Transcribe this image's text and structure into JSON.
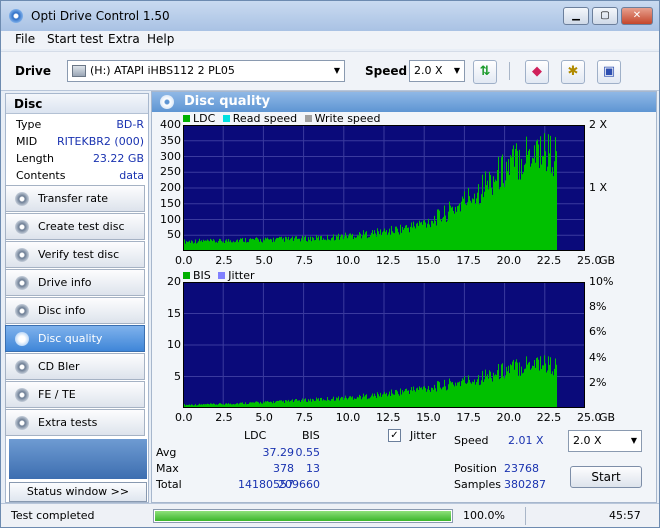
{
  "window": {
    "title": "Opti Drive Control 1.50",
    "minimize_icon": "minimize-icon",
    "maximize_icon": "maximize-icon",
    "close_icon": "close-icon"
  },
  "menu": [
    "File",
    "Start test",
    "Extra",
    "Help"
  ],
  "toolbar": {
    "drive_label": "Drive",
    "drive_value": "(H:)   ATAPI iHBS112   2 PL05",
    "speed_label": "Speed",
    "speed_value": "2.0 X",
    "buttons": [
      "refresh-icon",
      "eraser-icon",
      "settings-icon",
      "save-icon"
    ]
  },
  "disc": {
    "header": "Disc",
    "rows": [
      {
        "k": "Type",
        "v": "BD-R"
      },
      {
        "k": "MID",
        "v": "RITEKBR2 (000)"
      },
      {
        "k": "Length",
        "v": "23.22 GB"
      },
      {
        "k": "Contents",
        "v": "data"
      }
    ]
  },
  "nav": [
    {
      "label": "Transfer rate",
      "active": false
    },
    {
      "label": "Create test disc",
      "active": false
    },
    {
      "label": "Verify test disc",
      "active": false
    },
    {
      "label": "Drive info",
      "active": false
    },
    {
      "label": "Disc info",
      "active": false
    },
    {
      "label": "Disc quality",
      "active": true
    },
    {
      "label": "CD Bler",
      "active": false
    },
    {
      "label": "FE / TE",
      "active": false
    },
    {
      "label": "Extra tests",
      "active": false
    }
  ],
  "status_window_label": "Status window >>",
  "panel_title": "Disc quality",
  "chart_data": [
    {
      "type": "area",
      "legend": [
        "LDC",
        "Read speed",
        "Write speed"
      ],
      "x_unit": "GB",
      "x_ticks": [
        "0.0",
        "2.5",
        "5.0",
        "7.5",
        "10.0",
        "12.5",
        "15.0",
        "17.5",
        "20.0",
        "22.5",
        "25.0"
      ],
      "xlim": [
        0,
        25
      ],
      "y_ticks": [
        "50",
        "100",
        "150",
        "200",
        "250",
        "300",
        "350",
        "400"
      ],
      "ylim": [
        0,
        400
      ],
      "y2_ticks": [
        "1 X",
        "2 X"
      ],
      "series": [
        {
          "name": "LDC",
          "color": "#00c000",
          "x": [
            0,
            1,
            2,
            3,
            4,
            5,
            6,
            7,
            8,
            9,
            10,
            11,
            12,
            13,
            14,
            15,
            16,
            17,
            18,
            19,
            20,
            21,
            22,
            23.2
          ],
          "values": [
            30,
            32,
            30,
            34,
            36,
            35,
            37,
            38,
            40,
            42,
            48,
            52,
            58,
            65,
            75,
            90,
            110,
            140,
            180,
            220,
            260,
            300,
            330,
            300
          ]
        }
      ],
      "grid": true
    },
    {
      "type": "area",
      "legend": [
        "BIS",
        "Jitter"
      ],
      "x_unit": "GB",
      "x_ticks": [
        "0.0",
        "2.5",
        "5.0",
        "7.5",
        "10.0",
        "12.5",
        "15.0",
        "17.5",
        "20.0",
        "22.5",
        "25.0"
      ],
      "xlim": [
        0,
        25
      ],
      "y_ticks": [
        "5",
        "10",
        "15",
        "20"
      ],
      "ylim": [
        0,
        20
      ],
      "y2_ticks": [
        "2%",
        "4%",
        "6%",
        "8%",
        "10%"
      ],
      "series": [
        {
          "name": "BIS",
          "color": "#00c000",
          "x": [
            0,
            2,
            4,
            6,
            8,
            10,
            12,
            14,
            16,
            18,
            20,
            22,
            23.2
          ],
          "values": [
            0.5,
            0.6,
            0.8,
            1.0,
            1.3,
            1.6,
            2,
            2.8,
            3.5,
            4.5,
            6,
            7.5,
            6.5
          ]
        }
      ],
      "grid": true
    }
  ],
  "stats": {
    "headers": [
      "LDC",
      "BIS"
    ],
    "rows": [
      {
        "label": "Avg",
        "ldc": "37.29",
        "bis": "0.55"
      },
      {
        "label": "Max",
        "ldc": "378",
        "bis": "13"
      },
      {
        "label": "Total",
        "ldc": "14180557",
        "bis": "209660"
      }
    ],
    "jitter_label": "Jitter",
    "jitter_checked": "✓",
    "speed_label": "Speed",
    "speed_value": "2.01 X",
    "speed_select": "2.0 X",
    "position_label": "Position",
    "position_value": "23768",
    "samples_label": "Samples",
    "samples_value": "380287",
    "start_label": "Start"
  },
  "status": {
    "text": "Test completed",
    "progress": 1.0,
    "percent": "100.0%",
    "time": "45:57"
  }
}
